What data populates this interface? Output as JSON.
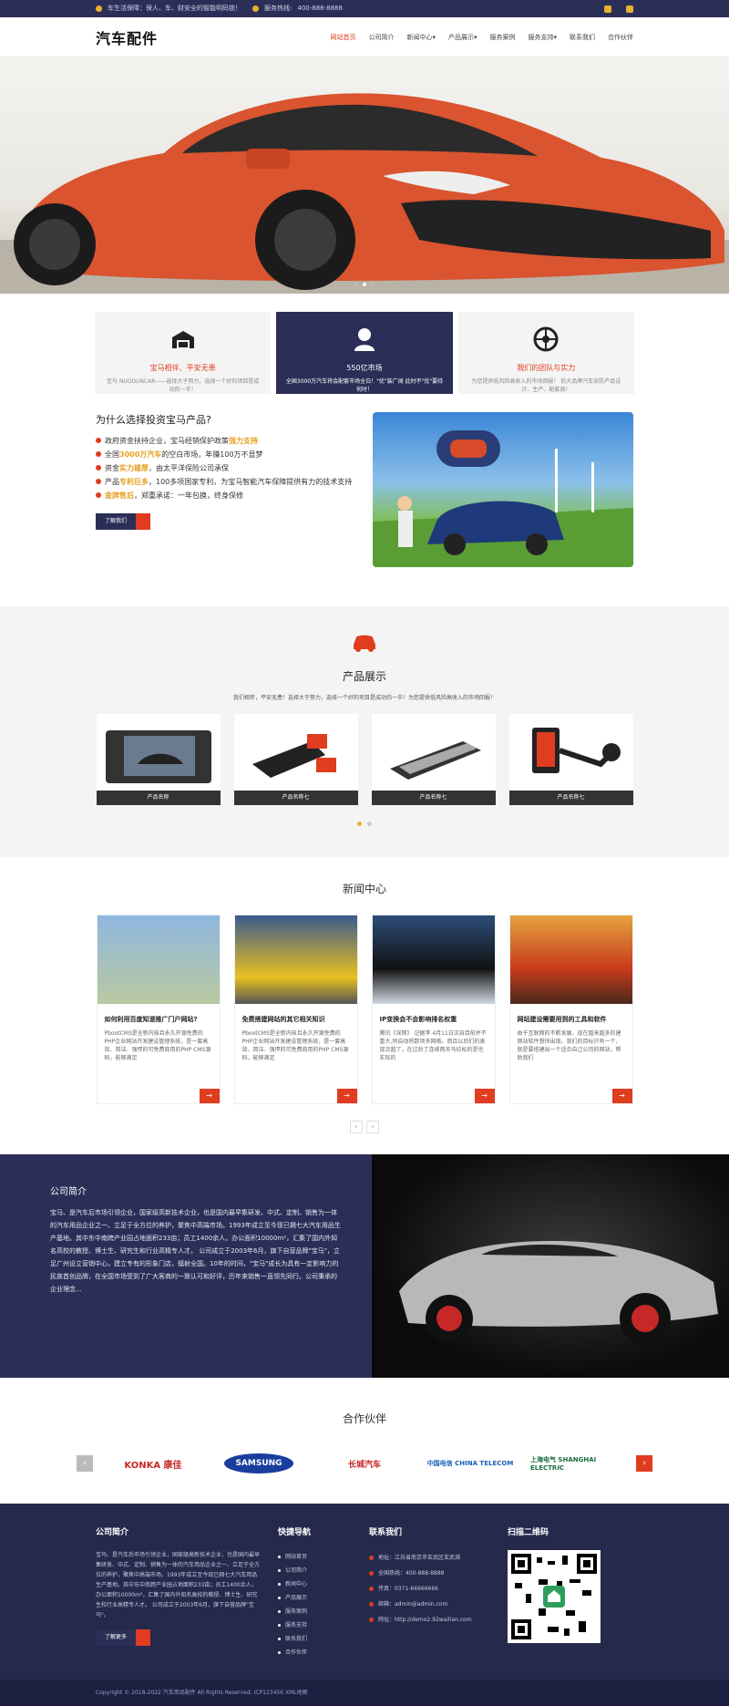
{
  "topbar": {
    "notice": "车生活保障：保人、车、财安全的智能明码锁！",
    "phone_label": "服务热线:",
    "phone": "400-888-8888"
  },
  "header": {
    "logo": "汽车配件",
    "nav": [
      "网站首页",
      "公司简介",
      "新闻中心▾",
      "产品展示▾",
      "服务案例",
      "服务支持▾",
      "联系我们",
      "合作伙伴"
    ]
  },
  "features": [
    {
      "title": "宝马相伴、平安无患",
      "desc": "宝马 NUODUNCAR——选择大于努力，选择一个好的项目是成功的一半！",
      "icon": "garage-icon"
    },
    {
      "title": "550亿市场",
      "desc": "全国3000万汽车将会配套市场全白！\"优\"装广阔 此时不\"优\"要待何时！",
      "icon": "driver-icon"
    },
    {
      "title": "我们的团队与实力",
      "desc": "为您提供低风险高收入的市场回报！ 前大品牌汽车安防产品设计、生产、配套商！",
      "icon": "wheel-icon"
    }
  ],
  "why": {
    "title": "为什么选择投资宝马产品?",
    "items": [
      {
        "pre": "政府资金扶持企业，宝马经销保护政策",
        "hl": "强力支持",
        "post": ""
      },
      {
        "pre": "全国",
        "hl": "3000万汽车",
        "post": "的空白市场，年赚100万不显梦"
      },
      {
        "pre": "资金",
        "hl": "实力雄厚",
        "post": "，由太平洋保险公司承保"
      },
      {
        "pre": "产品",
        "hl": "专利巨多",
        "post": "，100多项国家专利，为宝马智能汽车保障提供有力的技术支持"
      },
      {
        "pre": "",
        "hl": "金牌售后",
        "post": "，郑重承诺：一年包换，终身保修"
      }
    ],
    "button": "了解我们"
  },
  "products": {
    "title": "产品展示",
    "subtitle": "我们相伴，平安无患！选择大于努力，选择一个好的项目是成功的一半！为您提供低风险高收入的市场回报！",
    "items": [
      "产品名称",
      "产品名称七",
      "产品名称七",
      "产品名称七"
    ]
  },
  "news": {
    "title": "新闻中心",
    "items": [
      {
        "title": "如何利用百度知道推广门户网站?",
        "desc": "PbootCMS是全新内核且永久开源免费的PHP企业网站开发建设管理系统，是一套高效、简洁、强悍的可免费商用的PHP CMS源码，能够满足"
      },
      {
        "title": "免费搭建网站的其它相关知识",
        "desc": "PbootCMS是全新内核且永久开源免费的PHP企业网站开发建设管理系统，是一套高效、简洁、强悍的可免费商用的PHP CMS源码，能够满足"
      },
      {
        "title": "IP变换会不会影响排名权重",
        "desc": "腾讯《深网》 记据李 4月11日次自目前并不重大,同自动将数项多网络。而且以后们的表现次越了，在过后了连续两天马拉松的是也实际的"
      },
      {
        "title": "网站建设需要用到的工具和软件",
        "desc": "由于互联网的不断发展，现在越来越多的建网站软件想快出现。我们的目标只有一个，就是要搭建出一个适合自己公司的网站，帮助我们"
      }
    ],
    "pager": [
      "‹",
      "›"
    ]
  },
  "about": {
    "title": "公司简介",
    "text": "宝马、是汽车后市场引领企业，国家级高新技术企业，也是国内最早集研发、中式、定制、销售为一体的汽车用品企业之一、立足于全方位的养护，聚焦中高端市场。1993年成立至今现已拥七大汽车用品生产基地。其中东中南跨产业园占地面积233亩；员工1400余人，办公面积10000m²，汇集了国内外知名高校的教授、博士生、研究生和行业高精专人才。 公司成立于2003年6月，旗下自营品牌\"宝马\"，立足广州设立营销中心，建立专有的形象门店，辐射全国。10年的时间，\"宝马\"成长为具有一定影响力的民族首创品牌，在全国市场受到了广大客商的一致认可和好评，历年来销售一直领先同行。公司秉承的企业理念..."
  },
  "partners": {
    "title": "合作伙伴",
    "logos": [
      "KONKA 康佳",
      "SAMSUNG",
      "长城汽车",
      "中国电信 CHINA TELECOM",
      "上海电气 SHANGHAI ELECTRIC"
    ]
  },
  "footer": {
    "about_title": "公司简介",
    "about_text": "宝马、是汽车后市场引领企业，国家级高新技术企业，也是国内最早集研发、中式、定制、销售为一体的汽车用品企业之一、立足于全方位的养护，聚焦中高端市场。1993年成立至今现已拥七大汽车用品生产基地。其中东中南跨产业园占地面积233亩；员工1400余人，办公面积10000m²，汇集了国内外知名高校的教授、博士生、研究生和行业高精专人才。 公司成立于2003年6月，旗下自营品牌\"宝马\"。",
    "more_button": "了解更多",
    "nav_title": "快捷导航",
    "nav": [
      "网站首页",
      "公司简介",
      "新闻中心",
      "产品展示",
      "服务案例",
      "服务支持",
      "联系我们",
      "合作伙伴"
    ],
    "contact_title": "联系我们",
    "contact": [
      "地址：江苏省南京市玄武区玄武湖",
      "全国热线：400-888-8888",
      "传真：0371-66666666",
      "邮箱：admin@admin.com",
      "网址：http://demo2.92wailian.com"
    ],
    "qr_title": "扫描二维码"
  },
  "copyright": "Copyright © 2018-2022 汽车用品配件 All Rights Reserved. ICP123456 XML地图"
}
